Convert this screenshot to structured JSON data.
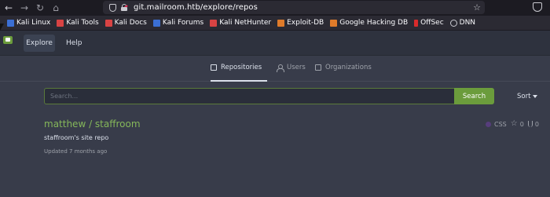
{
  "browser": {
    "url": "git.mailroom.htb/explore/repos"
  },
  "bookmarks": [
    {
      "label": "Kali Linux",
      "icon": "kali-icon",
      "color": "#3b6fd4"
    },
    {
      "label": "Kali Tools",
      "icon": "kali-tools-icon",
      "color": "#d94343"
    },
    {
      "label": "Kali Docs",
      "icon": "kali-docs-icon",
      "color": "#d94343"
    },
    {
      "label": "Kali Forums",
      "icon": "kali-forums-icon",
      "color": "#3b6fd4"
    },
    {
      "label": "Kali NetHunter",
      "icon": "nethunter-icon",
      "color": "#d94343"
    },
    {
      "label": "Exploit-DB",
      "icon": "exploit-db-icon",
      "color": "#e07b2a"
    },
    {
      "label": "Google Hacking DB",
      "icon": "ghdb-icon",
      "color": "#e07b2a"
    },
    {
      "label": "OffSec",
      "icon": "offsec-icon",
      "color": "#d92b2b"
    },
    {
      "label": "DNN",
      "icon": "globe-icon",
      "color": "#c9c9d0"
    }
  ],
  "header": {
    "explore_label": "Explore",
    "help_label": "Help"
  },
  "tabs": {
    "repositories": "Repositories",
    "users": "Users",
    "organizations": "Organizations"
  },
  "search": {
    "placeholder": "Search...",
    "button_label": "Search",
    "sort_label": "Sort"
  },
  "repos": [
    {
      "name": "matthew / staffroom",
      "description": "staffroom's site repo",
      "updated": "Updated 7 months ago",
      "language": "CSS",
      "language_color": "#563d7c",
      "stars": "0",
      "forks": "0"
    }
  ],
  "colors": {
    "accent": "#6b9c3c",
    "link": "#85b75a",
    "background": "#383c4a"
  }
}
